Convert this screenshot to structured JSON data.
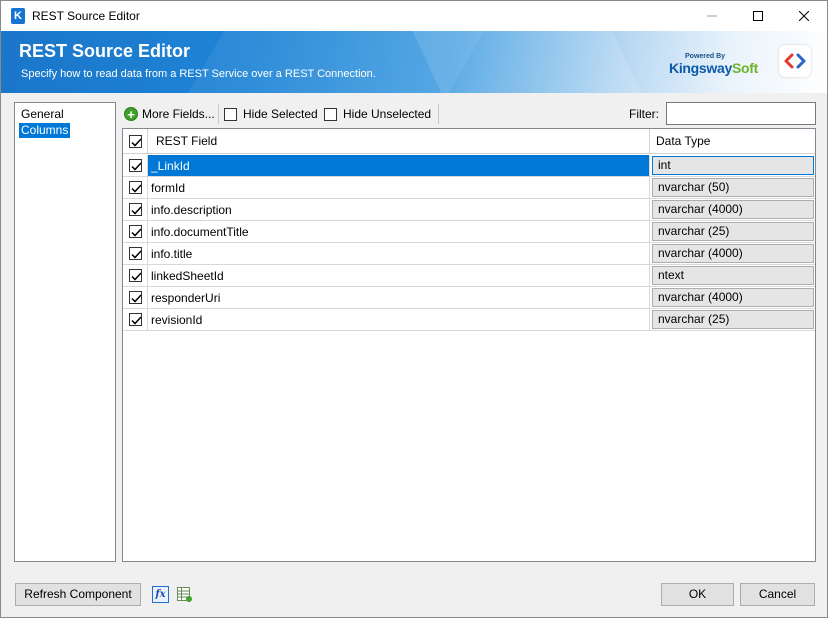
{
  "window": {
    "title": "REST Source Editor"
  },
  "banner": {
    "title": "REST Source Editor",
    "subtitle": "Specify how to read data from a REST Service over a REST Connection.",
    "logo_powered": "Powered By",
    "logo_brand_k": "K",
    "logo_brand_ingsway": "ingsway",
    "logo_brand_soft": "Soft"
  },
  "nav": {
    "items": [
      {
        "label": "General"
      },
      {
        "label": "Columns"
      }
    ],
    "selected": "Columns"
  },
  "toolbar": {
    "more_fields": "More Fields...",
    "hide_selected": "Hide Selected",
    "hide_unselected": "Hide Unselected",
    "filter_label": "Filter:",
    "filter_value": ""
  },
  "grid": {
    "columns": {
      "field": "REST Field",
      "type": "Data Type"
    },
    "rows": [
      {
        "field": "_LinkId",
        "type": "int",
        "checked": true
      },
      {
        "field": "formId",
        "type": "nvarchar (50)",
        "checked": true
      },
      {
        "field": "info.description",
        "type": "nvarchar (4000)",
        "checked": true
      },
      {
        "field": "info.documentTitle",
        "type": "nvarchar (25)",
        "checked": true
      },
      {
        "field": "info.title",
        "type": "nvarchar (4000)",
        "checked": true
      },
      {
        "field": "linkedSheetId",
        "type": "ntext",
        "checked": true
      },
      {
        "field": "responderUri",
        "type": "nvarchar (4000)",
        "checked": true
      },
      {
        "field": "revisionId",
        "type": "nvarchar (25)",
        "checked": true
      }
    ]
  },
  "footer": {
    "refresh": "Refresh Component",
    "fx": "fx",
    "ok": "OK",
    "cancel": "Cancel"
  },
  "colors": {
    "accent": "#0078d7",
    "banner": "#1a76c9",
    "brand_green": "#6bb42a"
  }
}
